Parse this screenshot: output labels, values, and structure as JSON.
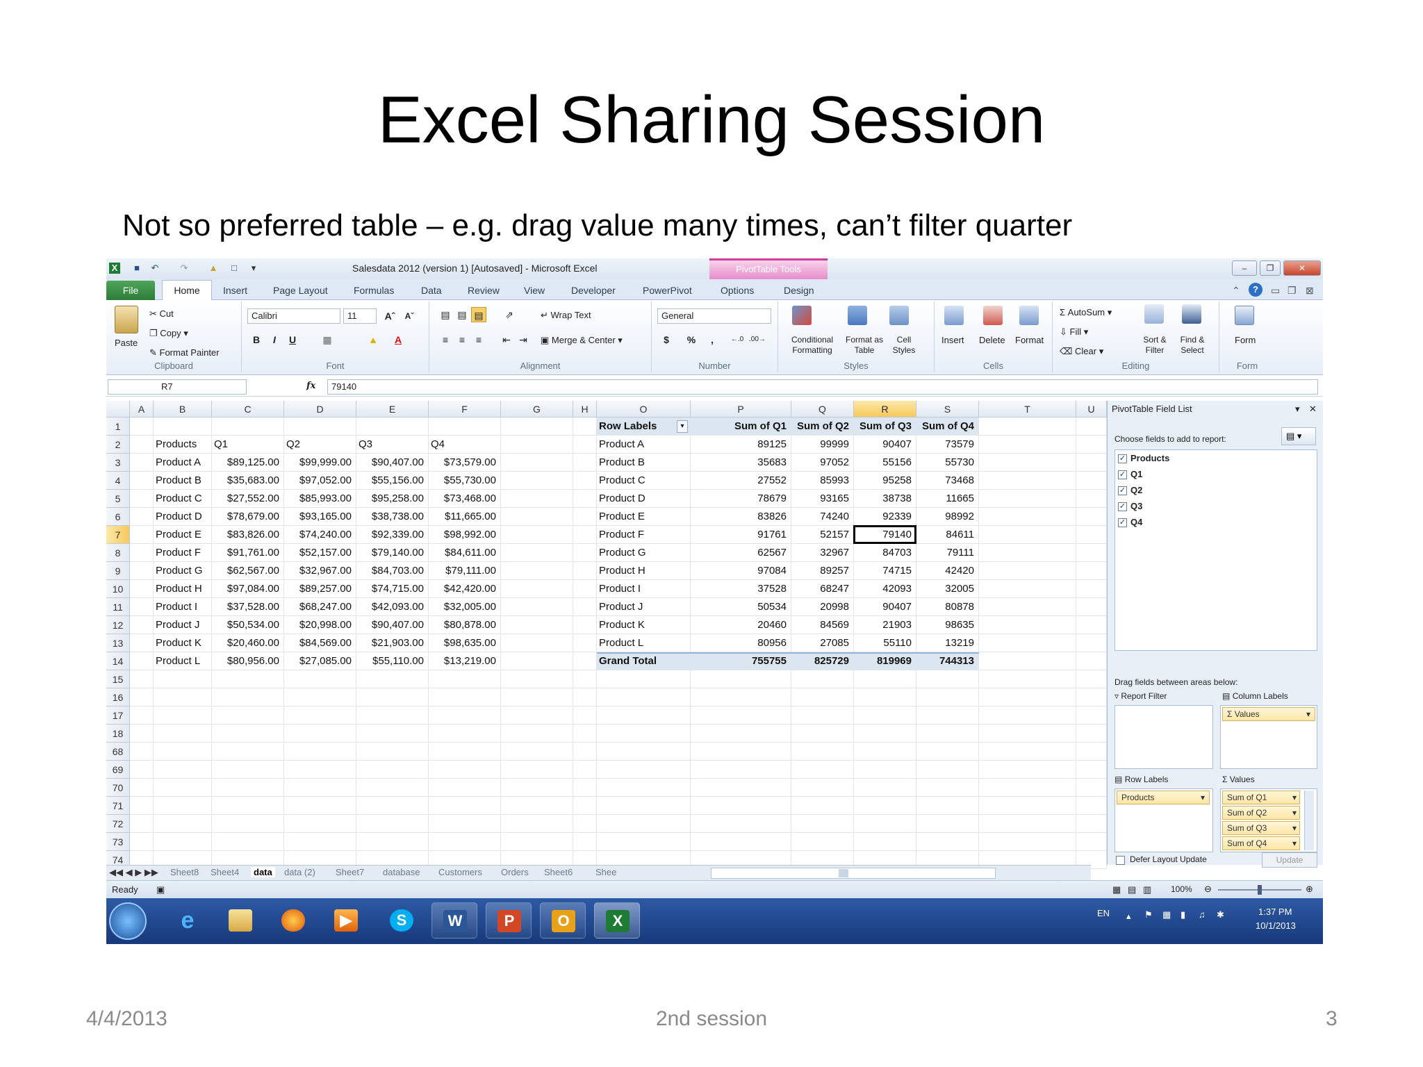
{
  "slide": {
    "title": "Excel Sharing Session",
    "subtitle": "Not so preferred table – e.g. drag value many times, can’t filter quarter",
    "footer_date": "4/4/2013",
    "footer_center": "2nd session",
    "footer_page": "3"
  },
  "excel": {
    "window_title": "Salesdata 2012 (version 1) [Autosaved] - Microsoft Excel",
    "context_tab": "PivotTable Tools",
    "tabs": [
      "File",
      "Home",
      "Insert",
      "Page Layout",
      "Formulas",
      "Data",
      "Review",
      "View",
      "Developer",
      "PowerPivot",
      "Options",
      "Design"
    ],
    "ribbon": {
      "clipboard": {
        "paste": "Paste",
        "cut": "Cut",
        "copy": "Copy",
        "format_painter": "Format Painter",
        "label": "Clipboard"
      },
      "font": {
        "family": "Calibri",
        "size": "11",
        "label": "Font",
        "bold": "B",
        "italic": "I",
        "underline": "U"
      },
      "alignment": {
        "wrap": "Wrap Text",
        "merge": "Merge & Center",
        "label": "Alignment"
      },
      "number": {
        "format": "General",
        "currency": "$",
        "percent": "%",
        "comma": ",",
        "label": "Number"
      },
      "styles": {
        "conditional": "Conditional Formatting",
        "format_table": "Format as Table",
        "cell_styles": "Cell Styles",
        "label": "Styles"
      },
      "cells": {
        "insert": "Insert",
        "delete": "Delete",
        "format": "Format",
        "label": "Cells"
      },
      "editing": {
        "autosum": "AutoSum",
        "fill": "Fill",
        "clear": "Clear",
        "sort": "Sort & Filter",
        "find": "Find & Select",
        "label": "Editing"
      },
      "form": {
        "form": "Form",
        "label": "Form"
      }
    },
    "name_box": "R7",
    "formula": "79140",
    "columns": [
      "A",
      "B",
      "C",
      "D",
      "E",
      "F",
      "G",
      "H",
      "O",
      "P",
      "Q",
      "R",
      "S",
      "T",
      "U"
    ],
    "rows": [
      "1",
      "2",
      "3",
      "4",
      "5",
      "6",
      "7",
      "8",
      "9",
      "10",
      "11",
      "12",
      "13",
      "14",
      "15",
      "16",
      "17",
      "18",
      "68",
      "69",
      "70",
      "71",
      "72",
      "73",
      "74"
    ],
    "table": {
      "headers": [
        "Products",
        "Q1",
        "Q2",
        "Q3",
        "Q4"
      ],
      "rows": [
        [
          "Product A",
          "$89,125.00",
          "$99,999.00",
          "$90,407.00",
          "$73,579.00"
        ],
        [
          "Product B",
          "$35,683.00",
          "$97,052.00",
          "$55,156.00",
          "$55,730.00"
        ],
        [
          "Product C",
          "$27,552.00",
          "$85,993.00",
          "$95,258.00",
          "$73,468.00"
        ],
        [
          "Product D",
          "$78,679.00",
          "$93,165.00",
          "$38,738.00",
          "$11,665.00"
        ],
        [
          "Product E",
          "$83,826.00",
          "$74,240.00",
          "$92,339.00",
          "$98,992.00"
        ],
        [
          "Product F",
          "$91,761.00",
          "$52,157.00",
          "$79,140.00",
          "$84,611.00"
        ],
        [
          "Product G",
          "$62,567.00",
          "$32,967.00",
          "$84,703.00",
          "$79,111.00"
        ],
        [
          "Product H",
          "$97,084.00",
          "$89,257.00",
          "$74,715.00",
          "$42,420.00"
        ],
        [
          "Product I",
          "$37,528.00",
          "$68,247.00",
          "$42,093.00",
          "$32,005.00"
        ],
        [
          "Product J",
          "$50,534.00",
          "$20,998.00",
          "$90,407.00",
          "$80,878.00"
        ],
        [
          "Product K",
          "$20,460.00",
          "$84,569.00",
          "$21,903.00",
          "$98,635.00"
        ],
        [
          "Product L",
          "$80,956.00",
          "$27,085.00",
          "$55,110.00",
          "$13,219.00"
        ]
      ]
    },
    "pivot": {
      "headers": [
        "Row Labels",
        "Sum of Q1",
        "Sum of Q2",
        "Sum of Q3",
        "Sum of Q4"
      ],
      "rows": [
        [
          "Product A",
          "89125",
          "99999",
          "90407",
          "73579"
        ],
        [
          "Product B",
          "35683",
          "97052",
          "55156",
          "55730"
        ],
        [
          "Product C",
          "27552",
          "85993",
          "95258",
          "73468"
        ],
        [
          "Product D",
          "78679",
          "93165",
          "38738",
          "11665"
        ],
        [
          "Product E",
          "83826",
          "74240",
          "92339",
          "98992"
        ],
        [
          "Product F",
          "91761",
          "52157",
          "79140",
          "84611"
        ],
        [
          "Product G",
          "62567",
          "32967",
          "84703",
          "79111"
        ],
        [
          "Product H",
          "97084",
          "89257",
          "74715",
          "42420"
        ],
        [
          "Product I",
          "37528",
          "68247",
          "42093",
          "32005"
        ],
        [
          "Product J",
          "50534",
          "20998",
          "90407",
          "80878"
        ],
        [
          "Product K",
          "20460",
          "84569",
          "21903",
          "98635"
        ],
        [
          "Product L",
          "80956",
          "27085",
          "55110",
          "13219"
        ]
      ],
      "grand_total": [
        "Grand Total",
        "755755",
        "825729",
        "819969",
        "744313"
      ]
    },
    "field_list": {
      "title": "PivotTable Field List",
      "choose": "Choose fields to add to report:",
      "fields": [
        "Products",
        "Q1",
        "Q2",
        "Q3",
        "Q4"
      ],
      "drag": "Drag fields between areas below:",
      "report_filter": "Report Filter",
      "column_labels": "Column Labels",
      "column_values_chip": "Values",
      "row_labels": "Row Labels",
      "values": "Values",
      "row_chip": "Products",
      "value_chips": [
        "Sum of Q1",
        "Sum of Q2",
        "Sum of Q3",
        "Sum of Q4"
      ],
      "defer": "Defer Layout Update",
      "update": "Update"
    },
    "sheet_tabs": [
      "Sheet8",
      "Sheet4",
      "data",
      "data (2)",
      "Sheet7",
      "database",
      "Customers",
      "Orders",
      "Sheet6",
      "Shee"
    ],
    "status": {
      "ready": "Ready",
      "zoom": "100%"
    },
    "taskbar": {
      "lang": "EN",
      "time": "1:37 PM",
      "date": "10/1/2013"
    }
  }
}
